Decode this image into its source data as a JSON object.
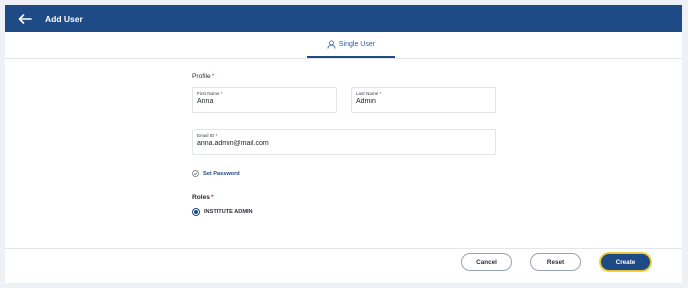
{
  "header": {
    "title": "Add User",
    "back_icon": "arrow-left-icon",
    "background": "#1e4b86"
  },
  "tabs": [
    {
      "label": "Single User",
      "icon": "user-icon",
      "active": true
    }
  ],
  "form": {
    "profile_label": "Profile",
    "required_mark": "*",
    "first_name": {
      "label": "First Name *",
      "value": "Anna"
    },
    "last_name": {
      "label": "Last Name *",
      "value": "Admin"
    },
    "email": {
      "label": "Email ID *",
      "value": "anna.admin@mail.com"
    },
    "set_password": {
      "label": "Set Password",
      "icon": "check-circle-icon"
    },
    "roles_label": "Roles",
    "roles": [
      {
        "label": "INSTITUTE ADMIN",
        "selected": true
      }
    ]
  },
  "footer": {
    "cancel_label": "Cancel",
    "reset_label": "Reset",
    "create_label": "Create",
    "accent": "#1e4b86",
    "focus_ring": "#f3d44a"
  }
}
